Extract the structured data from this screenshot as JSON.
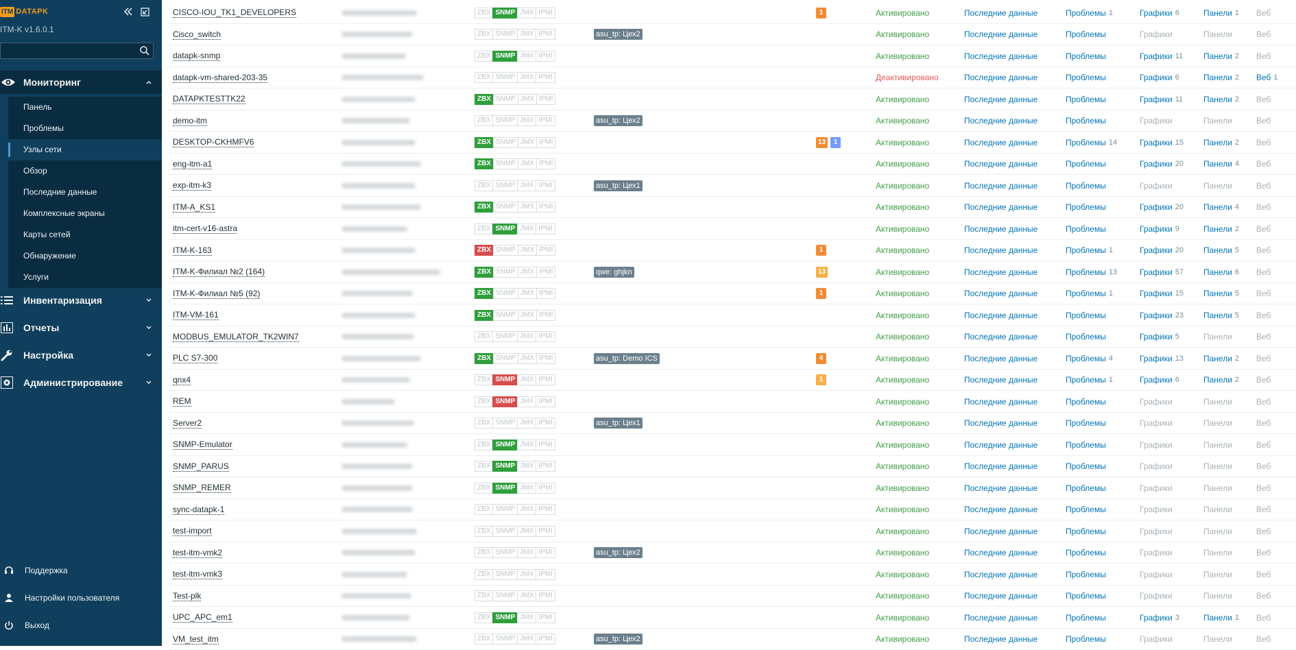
{
  "app": {
    "logo_badge": "ITM",
    "logo_text": "DATAPK",
    "version": "ITM-K v1.6.0.1",
    "search_placeholder": ""
  },
  "menu": {
    "monitoring": "Мониторинг",
    "monitoring_items": [
      "Панель",
      "Проблемы",
      "Узлы сети",
      "Обзор",
      "Последние данные",
      "Комплексные экраны",
      "Карты сетей",
      "Обнаружение",
      "Услуги"
    ],
    "selected_item": "Узлы сети",
    "inventory": "Инвентаризация",
    "reports": "Отчеты",
    "settings": "Настройка",
    "admin": "Администрирование"
  },
  "bottom_menu": {
    "support": "Поддержка",
    "user_settings": "Настройки пользователя",
    "logout": "Выход"
  },
  "colors": {
    "sidebar_bg": "#0f3f5c",
    "accent": "#f39c1b",
    "link": "#0275b8",
    "status_enabled": "#429e47",
    "status_disabled": "#e45959"
  },
  "labels": {
    "latest_data": "Последние данные",
    "problems": "Проблемы",
    "graphs": "Графики",
    "dashboards": "Панели",
    "web": "Веб",
    "zbx": "ZBX",
    "snmp": "SNMP",
    "jmx": "JMX",
    "ipmi": "IPMI"
  },
  "hosts": [
    {
      "name": "CISCO-IOU_TK1_DEVELOPERS",
      "zbx": "",
      "snmp": "green",
      "tag": "",
      "problems_badges": [
        {
          "v": "1",
          "c": "orange"
        }
      ],
      "status": "Активировано",
      "enabled": true,
      "problems_count": "1",
      "graphs": "6",
      "dash": "1",
      "web": ""
    },
    {
      "name": "Cisco_switch",
      "zbx": "",
      "snmp": "",
      "tag": "asu_tp: Цех2",
      "problems_badges": [],
      "status": "Активировано",
      "enabled": true,
      "problems_count": "",
      "graphs": "",
      "dash": "",
      "web": ""
    },
    {
      "name": "datapk-snmp",
      "zbx": "",
      "snmp": "green",
      "tag": "",
      "problems_badges": [],
      "status": "Активировано",
      "enabled": true,
      "problems_count": "",
      "graphs": "11",
      "dash": "2",
      "web": ""
    },
    {
      "name": "datapk-vm-shared-203-35",
      "zbx": "",
      "snmp": "",
      "tag": "",
      "problems_badges": [],
      "status": "Деактивировано",
      "enabled": false,
      "problems_count": "",
      "graphs": "6",
      "dash": "2",
      "web": "1"
    },
    {
      "name": "DATAPKTESTTK22",
      "zbx": "green",
      "snmp": "",
      "tag": "",
      "problems_badges": [],
      "status": "Активировано",
      "enabled": true,
      "problems_count": "",
      "graphs": "11",
      "dash": "2",
      "web": ""
    },
    {
      "name": "demo-itm",
      "zbx": "",
      "snmp": "",
      "tag": "asu_tp: Цех2",
      "problems_badges": [],
      "status": "Активировано",
      "enabled": true,
      "problems_count": "",
      "graphs": "",
      "dash": "",
      "web": ""
    },
    {
      "name": "DESKTOP-CKHMFV6",
      "zbx": "green",
      "snmp": "",
      "tag": "",
      "problems_badges": [
        {
          "v": "13",
          "c": "orange"
        },
        {
          "v": "1",
          "c": "blue"
        }
      ],
      "status": "Активировано",
      "enabled": true,
      "problems_count": "14",
      "graphs": "15",
      "dash": "2",
      "web": ""
    },
    {
      "name": "eng-itm-a1",
      "zbx": "green",
      "snmp": "",
      "tag": "",
      "problems_badges": [],
      "status": "Активировано",
      "enabled": true,
      "problems_count": "",
      "graphs": "20",
      "dash": "4",
      "web": ""
    },
    {
      "name": "exp-itm-k3",
      "zbx": "",
      "snmp": "",
      "tag": "asu_tp: Цех1",
      "problems_badges": [],
      "status": "Активировано",
      "enabled": true,
      "problems_count": "",
      "graphs": "",
      "dash": "",
      "web": ""
    },
    {
      "name": "ITM-A_KS1",
      "zbx": "green",
      "snmp": "",
      "tag": "",
      "problems_badges": [],
      "status": "Активировано",
      "enabled": true,
      "problems_count": "",
      "graphs": "20",
      "dash": "4",
      "web": ""
    },
    {
      "name": "itm-cert-v16-astra",
      "zbx": "",
      "snmp": "green",
      "tag": "",
      "problems_badges": [],
      "status": "Активировано",
      "enabled": true,
      "problems_count": "",
      "graphs": "9",
      "dash": "2",
      "web": ""
    },
    {
      "name": "ITM-K-163",
      "zbx": "red",
      "snmp": "",
      "tag": "",
      "problems_badges": [
        {
          "v": "1",
          "c": "orange"
        }
      ],
      "status": "Активировано",
      "enabled": true,
      "problems_count": "1",
      "graphs": "20",
      "dash": "5",
      "web": ""
    },
    {
      "name": "ITM-K-Филиал №2 (164)",
      "zbx": "green",
      "snmp": "",
      "tag": "qwe: ghjkn",
      "problems_badges": [
        {
          "v": "13",
          "c": "yellow"
        }
      ],
      "status": "Активировано",
      "enabled": true,
      "problems_count": "13",
      "graphs": "57",
      "dash": "6",
      "web": ""
    },
    {
      "name": "ITM-K-Филиал №5 (92)",
      "zbx": "green",
      "snmp": "",
      "tag": "",
      "problems_badges": [
        {
          "v": "1",
          "c": "orange"
        }
      ],
      "status": "Активировано",
      "enabled": true,
      "problems_count": "1",
      "graphs": "15",
      "dash": "5",
      "web": ""
    },
    {
      "name": "ITM-VM-161",
      "zbx": "green",
      "snmp": "",
      "tag": "",
      "problems_badges": [],
      "status": "Активировано",
      "enabled": true,
      "problems_count": "",
      "graphs": "23",
      "dash": "5",
      "web": ""
    },
    {
      "name": "MODBUS_EMULATOR_TK2WIN7",
      "zbx": "",
      "snmp": "",
      "tag": "",
      "problems_badges": [],
      "status": "Активировано",
      "enabled": true,
      "problems_count": "",
      "graphs": "5",
      "dash": "",
      "web": ""
    },
    {
      "name": "PLC S7-300",
      "zbx": "green",
      "snmp": "",
      "tag": "asu_tp: Demo ICS",
      "problems_badges": [
        {
          "v": "4",
          "c": "orange"
        }
      ],
      "status": "Активировано",
      "enabled": true,
      "problems_count": "4",
      "graphs": "13",
      "dash": "2",
      "web": ""
    },
    {
      "name": "qnx4",
      "zbx": "",
      "snmp": "red",
      "tag": "",
      "problems_badges": [
        {
          "v": "1",
          "c": "yellow"
        }
      ],
      "status": "Активировано",
      "enabled": true,
      "problems_count": "1",
      "graphs": "6",
      "dash": "2",
      "web": ""
    },
    {
      "name": "REM",
      "zbx": "",
      "snmp": "red",
      "tag": "",
      "problems_badges": [],
      "status": "Активировано",
      "enabled": true,
      "problems_count": "",
      "graphs": "",
      "dash": "",
      "web": ""
    },
    {
      "name": "Server2",
      "zbx": "",
      "snmp": "",
      "tag": "asu_tp: Цех1",
      "problems_badges": [],
      "status": "Активировано",
      "enabled": true,
      "problems_count": "",
      "graphs": "",
      "dash": "",
      "web": ""
    },
    {
      "name": "SNMP-Emulator",
      "zbx": "",
      "snmp": "green",
      "tag": "",
      "problems_badges": [],
      "status": "Активировано",
      "enabled": true,
      "problems_count": "",
      "graphs": "",
      "dash": "",
      "web": ""
    },
    {
      "name": "SNMP_PARUS",
      "zbx": "",
      "snmp": "green",
      "tag": "",
      "problems_badges": [],
      "status": "Активировано",
      "enabled": true,
      "problems_count": "",
      "graphs": "",
      "dash": "",
      "web": ""
    },
    {
      "name": "SNMP_REMER",
      "zbx": "",
      "snmp": "green",
      "tag": "",
      "problems_badges": [],
      "status": "Активировано",
      "enabled": true,
      "problems_count": "",
      "graphs": "",
      "dash": "",
      "web": ""
    },
    {
      "name": "sync-datapk-1",
      "zbx": "",
      "snmp": "",
      "tag": "",
      "problems_badges": [],
      "status": "Активировано",
      "enabled": true,
      "problems_count": "",
      "graphs": "",
      "dash": "",
      "web": ""
    },
    {
      "name": "test-import",
      "zbx": "",
      "snmp": "",
      "tag": "",
      "problems_badges": [],
      "status": "Активировано",
      "enabled": true,
      "problems_count": "",
      "graphs": "",
      "dash": "",
      "web": ""
    },
    {
      "name": "test-itm-vmk2",
      "zbx": "",
      "snmp": "",
      "tag": "asu_tp: Цех2",
      "problems_badges": [],
      "status": "Активировано",
      "enabled": true,
      "problems_count": "",
      "graphs": "",
      "dash": "",
      "web": ""
    },
    {
      "name": "test-itm-vmk3",
      "zbx": "",
      "snmp": "",
      "tag": "",
      "problems_badges": [],
      "status": "Активировано",
      "enabled": true,
      "problems_count": "",
      "graphs": "",
      "dash": "",
      "web": ""
    },
    {
      "name": "Test-plk",
      "zbx": "",
      "snmp": "",
      "tag": "",
      "problems_badges": [],
      "status": "Активировано",
      "enabled": true,
      "problems_count": "",
      "graphs": "",
      "dash": "",
      "web": ""
    },
    {
      "name": "UPC_APC_em1",
      "zbx": "",
      "snmp": "green",
      "tag": "",
      "problems_badges": [],
      "status": "Активировано",
      "enabled": true,
      "problems_count": "",
      "graphs": "3",
      "dash": "1",
      "web": ""
    },
    {
      "name": "VM_test_itm",
      "zbx": "",
      "snmp": "",
      "tag": "asu_tp: Цех2",
      "problems_badges": [],
      "status": "Активировано",
      "enabled": true,
      "problems_count": "",
      "graphs": "",
      "dash": "",
      "web": ""
    }
  ]
}
